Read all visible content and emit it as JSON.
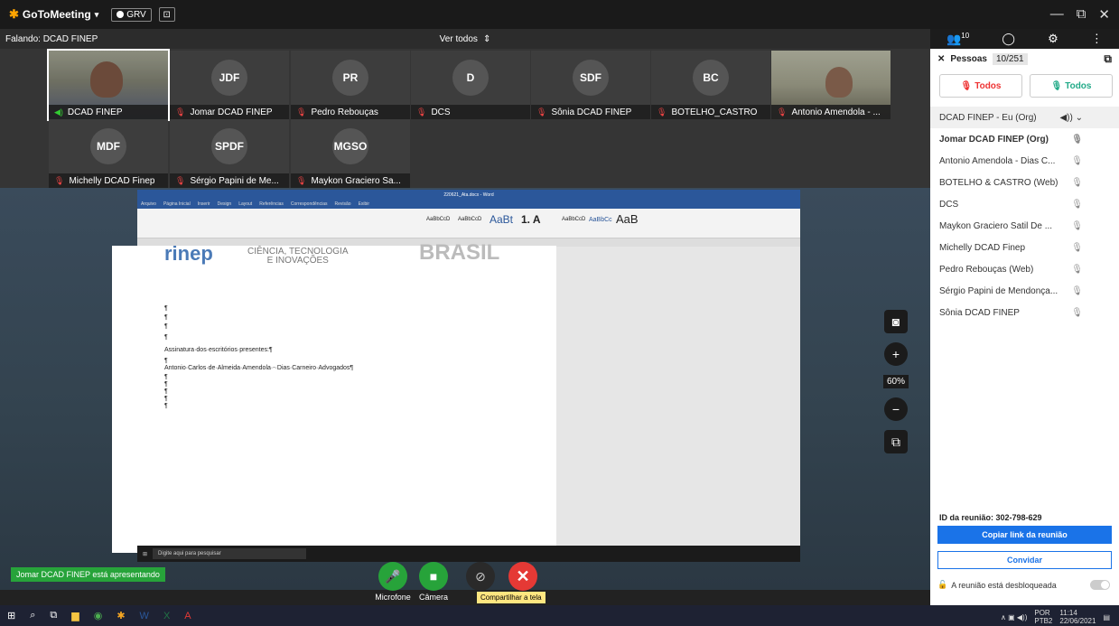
{
  "app": {
    "name": "GoToMeeting",
    "dropdown": "▾"
  },
  "grv": {
    "label": "GRV"
  },
  "window": {
    "min": "—",
    "max": "⧉",
    "close": "✕"
  },
  "speaking": {
    "label": "Falando: DCAD FINEP"
  },
  "view": {
    "label": "Ver todos",
    "icon": "⇕"
  },
  "header_right": {
    "people_count": "10"
  },
  "tiles": [
    {
      "initials": "",
      "name": "DCAD FINEP",
      "muted": false
    },
    {
      "initials": "JDF",
      "name": "Jomar DCAD FINEP",
      "muted": true
    },
    {
      "initials": "PR",
      "name": "Pedro Rebouças",
      "muted": true
    },
    {
      "initials": "D",
      "name": "DCS",
      "muted": true
    },
    {
      "initials": "SDF",
      "name": "Sônia DCAD FINEP",
      "muted": true
    },
    {
      "initials": "BC",
      "name": "BOTELHO_CASTRO",
      "muted": true
    },
    {
      "initials": "",
      "name": "Antonio Amendola - ...",
      "muted": true
    },
    {
      "initials": "MDF",
      "name": "Michelly DCAD Finep",
      "muted": true
    },
    {
      "initials": "SPDF",
      "name": "Sérgio Papini de Me...",
      "muted": true
    },
    {
      "initials": "MGSO",
      "name": "Maykon Graciero Sa...",
      "muted": true
    }
  ],
  "word": {
    "title": "220621_Ata.docx - Word",
    "tabs": [
      "Arquivo",
      "Página Inicial",
      "Inserir",
      "Design",
      "Layout",
      "Referências",
      "Correspondências",
      "Revisão",
      "Exibir"
    ],
    "styles": [
      "AaBbCcD",
      "AaBbCcD",
      "AaBt",
      "1. A",
      "AaBbCcD",
      "AaBbCc",
      "AaB"
    ],
    "logo_left": "rinep",
    "logo_mid_1": "CIÊNCIA, TECNOLOGIA",
    "logo_mid_2": "E INOVAÇÕES",
    "logo_right": "BRASIL",
    "para_mark": "¶",
    "line_sign": "Assinatura·dos·escritórios·presentes:¶",
    "line_name": "Antonio·Carlos·de·Almeida·Amendola·-·Dias·Carneiro·Advogados¶",
    "taskbar_search": "Digite aqui para pesquisar"
  },
  "zoom": {
    "level": "60%"
  },
  "presenting": {
    "label": "Jomar DCAD FINEP está apresentando"
  },
  "controls": {
    "mic": "Microfone",
    "camera": "Câmera",
    "share_tooltip": "Compartilhar a tela"
  },
  "panel": {
    "title": "Pessoas",
    "count": "10/251",
    "mute_all": "Todos",
    "unmute_all": "Todos",
    "people": [
      {
        "name": "DCAD FINEP - Eu (Org)",
        "me": true,
        "bold": false
      },
      {
        "name": "Jomar DCAD FINEP (Org)",
        "me": false,
        "bold": true
      },
      {
        "name": "Antonio Amendola - Dias C...",
        "me": false,
        "bold": false
      },
      {
        "name": "BOTELHO & CASTRO (Web)",
        "me": false,
        "bold": false
      },
      {
        "name": "DCS",
        "me": false,
        "bold": false
      },
      {
        "name": "Maykon Graciero Satil De ...",
        "me": false,
        "bold": false
      },
      {
        "name": "Michelly DCAD Finep",
        "me": false,
        "bold": false
      },
      {
        "name": "Pedro Rebouças (Web)",
        "me": false,
        "bold": false
      },
      {
        "name": "Sérgio Papini de Mendonça...",
        "me": false,
        "bold": false
      },
      {
        "name": "Sônia DCAD FINEP",
        "me": false,
        "bold": false
      }
    ],
    "meeting_id": "ID da reunião: 302-798-629",
    "copy_link": "Copiar link da reunião",
    "invite": "Convidar",
    "unlocked": "A reunião está desbloqueada"
  },
  "taskbar": {
    "lang": "POR",
    "layout": "PTB2",
    "time": "11:14",
    "date": "22/06/2021"
  }
}
